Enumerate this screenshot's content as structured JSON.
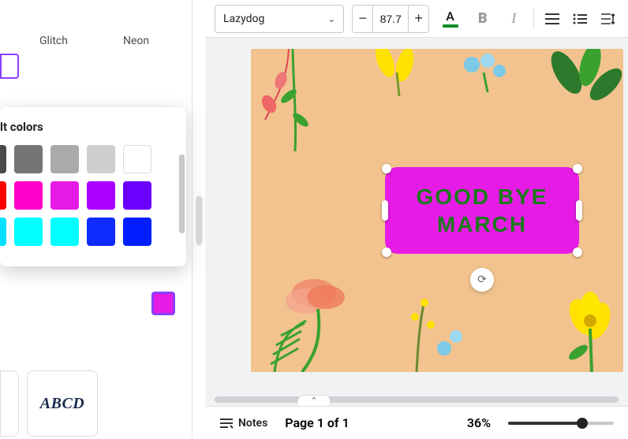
{
  "toolbar": {
    "font_name": "Lazydog",
    "font_size": "87.7",
    "text_color": "#108c28",
    "bold_label": "B",
    "italic_label": "I",
    "color_letter": "A"
  },
  "left_panel": {
    "tabs": [
      "Glitch",
      "Neon"
    ],
    "popover_title": "lt colors",
    "selected_color": "#e61ce6",
    "swatch_rows": [
      [
        "#4a4a4a",
        "#757575",
        "#aaaaaa",
        "#cfcfcf",
        "#ffffff"
      ],
      [
        "#ff0000",
        "#ff00c8",
        "#e61ce6",
        "#aa00ff",
        "#6b00ff"
      ],
      [
        "#00e0ff",
        "#00ffff",
        "#00ffff",
        "#0f2cff",
        "#001eff"
      ]
    ],
    "card_label": "ABCD"
  },
  "canvas": {
    "text_line1": "GOOD BYE",
    "text_line2": "MARCH",
    "textbox_bg": "#e61ce6",
    "text_color": "#1a7a1a",
    "canvas_bg": "#f2c38f"
  },
  "bottombar": {
    "notes_label": "Notes",
    "page_info": "Page 1 of 1",
    "zoom_label": "36%"
  }
}
